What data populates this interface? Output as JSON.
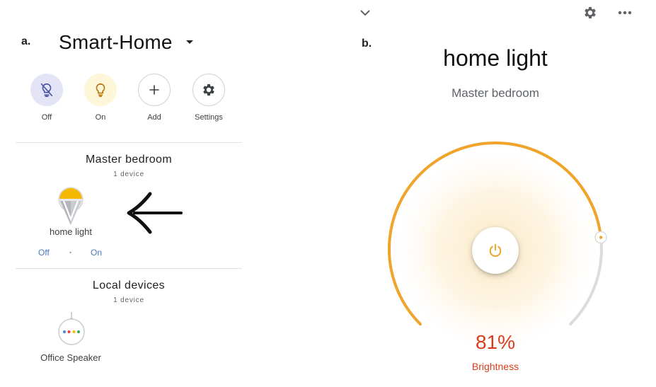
{
  "panel_a": {
    "label": "a.",
    "home_name": "Smart-Home",
    "quick_actions": [
      {
        "label": "Off",
        "icon": "lightbulb-off-icon"
      },
      {
        "label": "On",
        "icon": "lightbulb-icon"
      },
      {
        "label": "Add",
        "icon": "plus-icon"
      },
      {
        "label": "Settings",
        "icon": "gear-icon"
      }
    ],
    "rooms": [
      {
        "title": "Master bedroom",
        "device_count": "1 device",
        "devices": [
          {
            "name": "home light",
            "icon": "smart-bulb-icon",
            "toggle_off": "Off",
            "toggle_separator": "•",
            "toggle_on": "On"
          }
        ]
      },
      {
        "title": "Local devices",
        "device_count": "1 device",
        "devices": [
          {
            "name": "Office Speaker",
            "icon": "smart-speaker-icon"
          }
        ]
      }
    ]
  },
  "panel_b": {
    "label": "b.",
    "device_name": "home light",
    "room": "Master bedroom",
    "brightness": {
      "value_text": "81%",
      "label": "Brightness",
      "level_percent": 81
    }
  },
  "colors": {
    "accent_orange": "#f0a42a",
    "brightness_red": "#d93d1e",
    "toggle_blue": "#4a78c2",
    "off_bg": "#e3e5f6",
    "on_bg": "#fdf6d8"
  }
}
